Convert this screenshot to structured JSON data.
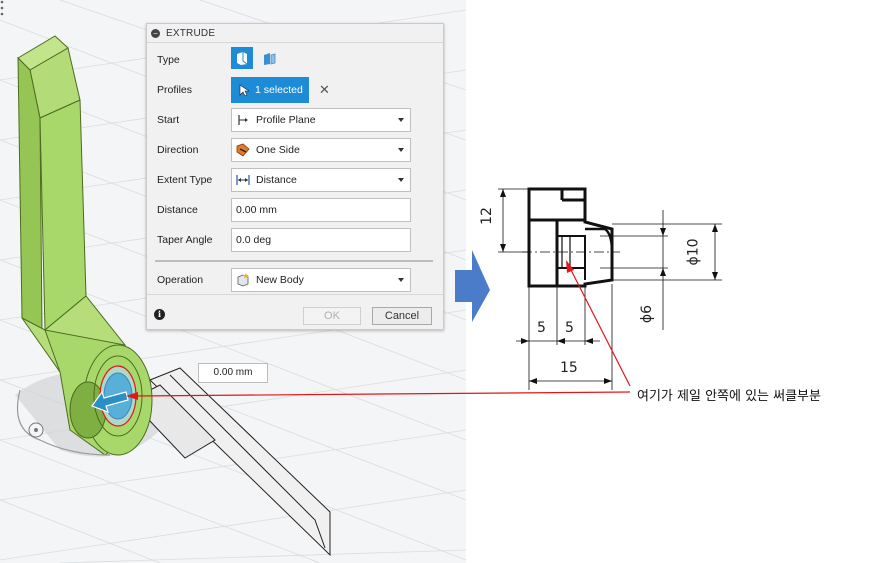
{
  "dialog": {
    "title": "EXTRUDE",
    "type_label": "Type",
    "profiles_label": "Profiles",
    "profiles_value": "1 selected",
    "start_label": "Start",
    "start_value": "Profile Plane",
    "direction_label": "Direction",
    "direction_value": "One Side",
    "extent_label": "Extent Type",
    "extent_value": "Distance",
    "distance_label": "Distance",
    "distance_value": "0.00 mm",
    "taper_label": "Taper Angle",
    "taper_value": "0.0 deg",
    "operation_label": "Operation",
    "operation_value": "New Body",
    "ok_label": "OK",
    "cancel_label": "Cancel"
  },
  "viewport": {
    "distance_box_value": "0.00 mm"
  },
  "drawing": {
    "dim_12": "12",
    "dim_5a": "5",
    "dim_5b": "5",
    "dim_15": "15",
    "dim_phi10": "ϕ10",
    "dim_phi6": "ϕ6",
    "annotation": "여기가 제일 안쪽에 있는 써클부분"
  },
  "colors": {
    "accent": "#1e8bd6",
    "model_green": "#a8d86a",
    "annotation_red": "#e0161b",
    "arrow_blue": "#4a7cc9"
  }
}
